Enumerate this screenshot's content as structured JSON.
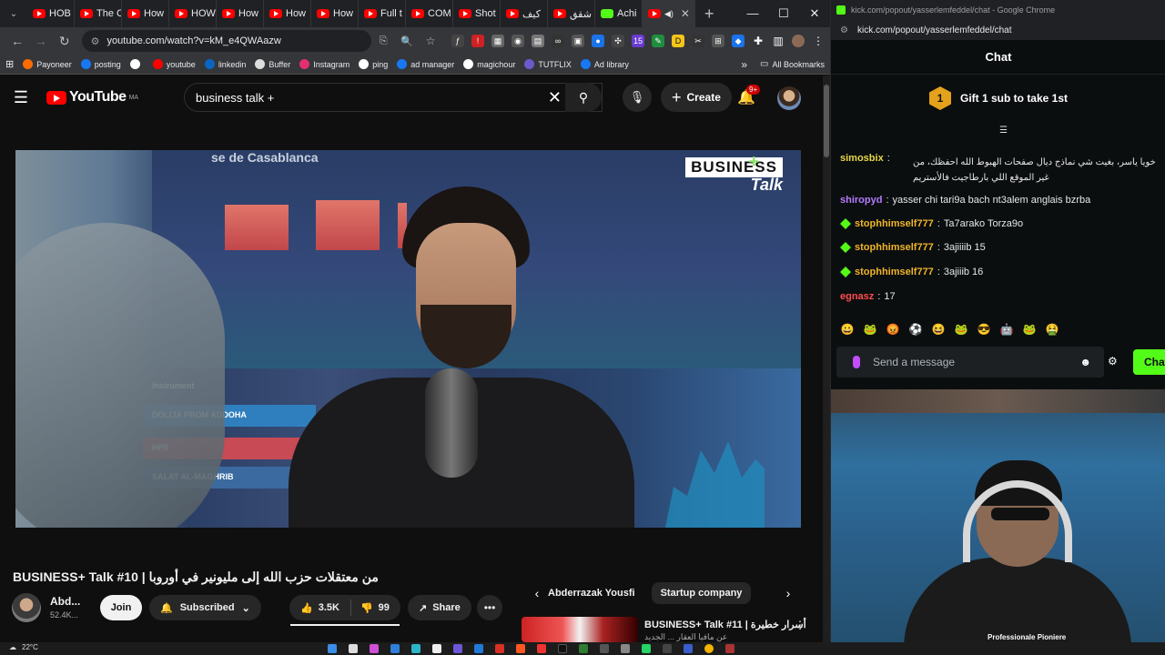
{
  "browser": {
    "tabs": [
      {
        "label": "HOB"
      },
      {
        "label": "The C"
      },
      {
        "label": "How"
      },
      {
        "label": "HOW"
      },
      {
        "label": "How"
      },
      {
        "label": "How"
      },
      {
        "label": "How"
      },
      {
        "label": "Full t"
      },
      {
        "label": "COM"
      },
      {
        "label": "Shot"
      },
      {
        "label": "كيف"
      },
      {
        "label": "شقق"
      },
      {
        "label": "Achi"
      }
    ],
    "url": "youtube.com/watch?v=kM_e4QWAazw",
    "bookmarks": [
      {
        "label": "Payoneer",
        "color": "#ff6b00"
      },
      {
        "label": "posting",
        "color": "#1877f2"
      },
      {
        "label": "",
        "color": "#ffffff"
      },
      {
        "label": "youtube",
        "color": "#ff0000"
      },
      {
        "label": "linkedin",
        "color": "#0a66c2"
      },
      {
        "label": "Buffer",
        "color": "#dddddd"
      },
      {
        "label": "Instagram",
        "color": "#e1306c"
      },
      {
        "label": "ping",
        "color": "#ffffff"
      },
      {
        "label": "ad manager",
        "color": "#1877f2"
      },
      {
        "label": "magichour",
        "color": "#ffffff"
      },
      {
        "label": "TUTFLIX",
        "color": "#6a5acd"
      },
      {
        "label": "Ad library",
        "color": "#1877f2"
      }
    ],
    "bookmarks_more": "»",
    "all_bookmarks": "All Bookmarks"
  },
  "youtube": {
    "logo_text": "YouTube",
    "country_code": "MA",
    "search_value": "business talk +",
    "create_label": "Create",
    "notifications": "9+",
    "video": {
      "brand_line1": "BUSINESS",
      "brand_line2": "Talk",
      "board_title": "se de Casablanca",
      "instruments": [
        "Instrument",
        "DOLIJA PROM ADDOHA",
        "HPS",
        "SALAT AL-MAGHRIB"
      ]
    },
    "title": "BUSINESS+ Talk #10 | من معتقلات حزب الله إلى مليونير في أوروبا",
    "channel": {
      "name": "Abd...",
      "subs": "52.4K..."
    },
    "join_label": "Join",
    "subscribed_label": "Subscribed",
    "likes": "3.5K",
    "dislikes": "99",
    "share_label": "Share",
    "chips": [
      "Abderrazak Yousfi",
      "Startup company"
    ],
    "rec": {
      "title": "BUSINESS+ Talk #11 | أسرار خطيرة",
      "subtitle": "عن مافيا العقار ... الجديد"
    }
  },
  "kick": {
    "window_title": "kick.com/popout/yasserlemfeddel/chat - Google Chrome",
    "url": "kick.com/popout/yasserlemfeddel/chat",
    "chat_title": "Chat",
    "gift_count": "1",
    "gift_label": "Gift 1 sub to take 1st",
    "messages": [
      {
        "user": "simosbix",
        "color": "#e9d745",
        "text": "خويا ياسر، بغيت شي نماذج ديال صفحات الهبوط الله احفظك، من غير الموقع اللي بارطاجيت فالأستريم",
        "badge": false
      },
      {
        "user": "shiropyd",
        "color": "#b57cff",
        "text": "yasser chi tari9a bach nt3alem anglais bzrba",
        "badge": false
      },
      {
        "user": "stophhimself777",
        "color": "#f0b429",
        "text": "Ta7arako Torza9o",
        "badge": true
      },
      {
        "user": "stophhimself777",
        "color": "#f0b429",
        "text": "3ajiiiib 15",
        "badge": true
      },
      {
        "user": "stophhimself777",
        "color": "#f0b429",
        "text": "3ajiiib 16",
        "badge": true
      },
      {
        "user": "egnasz",
        "color": "#ff4d4d",
        "text": "17",
        "badge": false
      }
    ],
    "emotes": [
      "😀",
      "🐸",
      "😡",
      "⚽",
      "😆",
      "🐸",
      "😎",
      "🤖",
      "🐸",
      "🤮"
    ],
    "send_placeholder": "Send a message",
    "chat_button": "Chat",
    "shirt_text": "Professionale Pioniere"
  },
  "taskbar": {
    "temperature": "22°C"
  }
}
